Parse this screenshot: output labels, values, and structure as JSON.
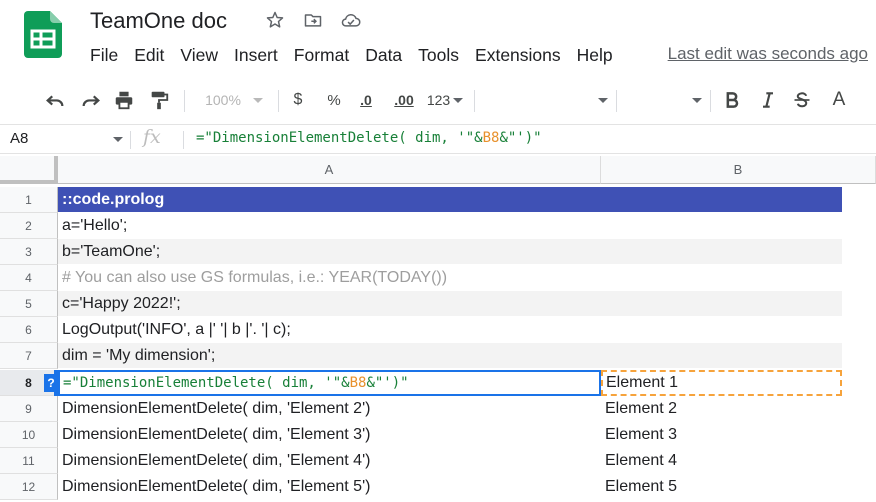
{
  "doc": {
    "title": "TeamOne doc",
    "last_edit": "Last edit was seconds ago"
  },
  "menu": [
    "File",
    "Edit",
    "View",
    "Insert",
    "Format",
    "Data",
    "Tools",
    "Extensions",
    "Help"
  ],
  "toolbar": {
    "zoom": "100%",
    "currency": "$",
    "percent": "%",
    "decrease_decimal": ".0",
    "increase_decimal": ".00",
    "number_format": "123",
    "font_a_label": "A"
  },
  "formula_bar": {
    "cell_ref": "A8",
    "fx": "fx",
    "formula_part1": "=\"DimensionElementDelete( dim, '\"&",
    "formula_ref": "B8",
    "formula_part2": "&\"')\""
  },
  "grid": {
    "columns": [
      "A",
      "B"
    ],
    "rows": [
      {
        "num": "1",
        "a": "::code.prolog",
        "b": ""
      },
      {
        "num": "2",
        "a": "a='Hello';",
        "b": ""
      },
      {
        "num": "3",
        "a": "b='TeamOne';",
        "b": ""
      },
      {
        "num": "4",
        "a": "# You can also use GS formulas, i.e.: YEAR(TODAY())",
        "b": ""
      },
      {
        "num": "5",
        "a": "c='Happy 2022!';",
        "b": ""
      },
      {
        "num": "6",
        "a": "LogOutput('INFO', a |' '| b |'. '| c);",
        "b": ""
      },
      {
        "num": "7",
        "a": "dim = 'My dimension';",
        "b": ""
      },
      {
        "num": "8",
        "a": "",
        "b": "Element 1"
      },
      {
        "num": "9",
        "a": "DimensionElementDelete( dim, 'Element 2')",
        "b": "Element 2"
      },
      {
        "num": "10",
        "a": "DimensionElementDelete( dim, 'Element 3')",
        "b": "Element 3"
      },
      {
        "num": "11",
        "a": "DimensionElementDelete( dim, 'Element 4')",
        "b": "Element 4"
      },
      {
        "num": "12",
        "a": "DimensionElementDelete( dim, 'Element 5')",
        "b": "Element 5"
      }
    ],
    "help_badge": "?"
  },
  "colors": {
    "header_row": "#3f51b5",
    "selection": "#1a73e8",
    "ref_border": "#f6a33c",
    "formula_string": "#188038",
    "formula_ref": "#e8912d"
  }
}
